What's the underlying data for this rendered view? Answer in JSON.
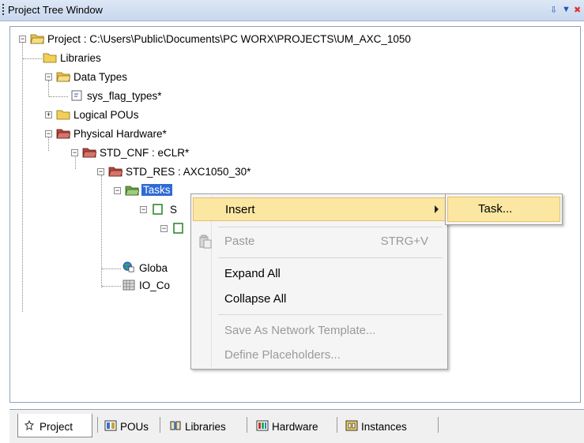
{
  "window": {
    "title": "Project Tree Window",
    "pin_glyph": "⇩",
    "dropdown_glyph": "▼",
    "close_glyph": "✖"
  },
  "tree": {
    "project": "Project : C:\\Users\\Public\\Documents\\PC WORX\\PROJECTS\\UM_AXC_1050",
    "libraries": "Libraries",
    "data_types": "Data Types",
    "sys_flag_types": "sys_flag_types*",
    "logical_pous": "Logical POUs",
    "physical_hardware": "Physical Hardware*",
    "std_cnf": "STD_CNF : eCLR*",
    "std_res": "STD_RES : AXC1050_30*",
    "tasks": "Tasks",
    "task_child_fragment": "S",
    "globals_fragment": "Globa",
    "io_fragment": "IO_Co"
  },
  "context_menu": {
    "insert": "Insert",
    "paste": "Paste",
    "paste_shortcut": "STRG+V",
    "expand_all": "Expand All",
    "collapse_all": "Collapse All",
    "save_as_template": "Save As Network Template...",
    "define_placeholders": "Define Placeholders..."
  },
  "submenu": {
    "task": "Task..."
  },
  "tabs": [
    {
      "label": "Project",
      "icon": "project-icon",
      "active": true
    },
    {
      "label": "POUs",
      "icon": "pous-icon",
      "active": false
    },
    {
      "label": "Libraries",
      "icon": "libraries-icon",
      "active": false
    },
    {
      "label": "Hardware",
      "icon": "hardware-icon",
      "active": false
    },
    {
      "label": "Instances",
      "icon": "instances-icon",
      "active": false
    }
  ],
  "colors": {
    "selection": "#2e6ad5",
    "menu_highlight": "#fbe6a2",
    "folder": "#f2cf57"
  }
}
